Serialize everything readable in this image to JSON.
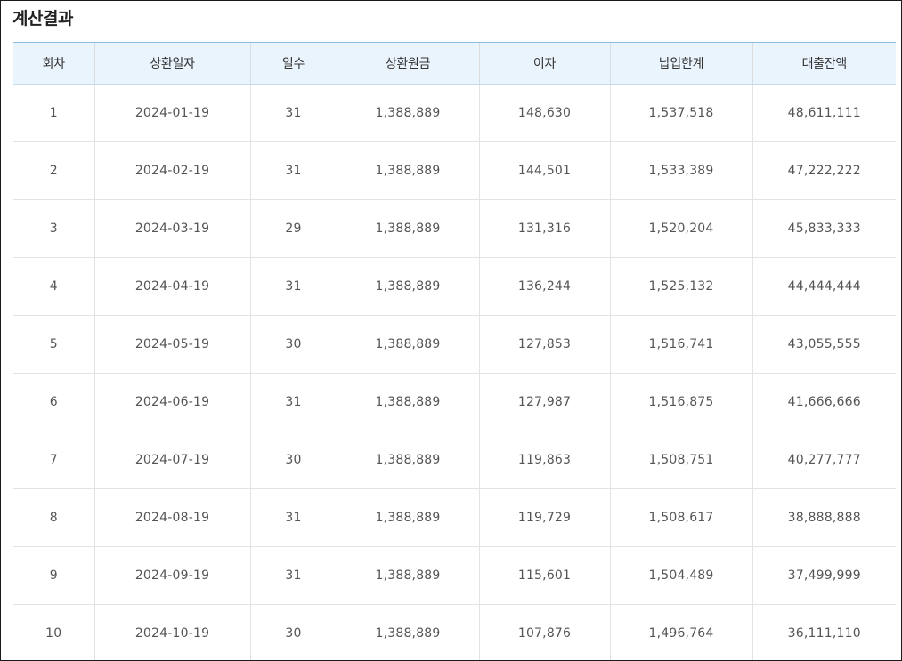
{
  "title": "계산결과",
  "table": {
    "headers": [
      "회차",
      "상환일자",
      "일수",
      "상환원금",
      "이자",
      "납입한계",
      "대출잔액"
    ],
    "rows": [
      [
        "1",
        "2024-01-19",
        "31",
        "1,388,889",
        "148,630",
        "1,537,518",
        "48,611,111"
      ],
      [
        "2",
        "2024-02-19",
        "31",
        "1,388,889",
        "144,501",
        "1,533,389",
        "47,222,222"
      ],
      [
        "3",
        "2024-03-19",
        "29",
        "1,388,889",
        "131,316",
        "1,520,204",
        "45,833,333"
      ],
      [
        "4",
        "2024-04-19",
        "31",
        "1,388,889",
        "136,244",
        "1,525,132",
        "44,444,444"
      ],
      [
        "5",
        "2024-05-19",
        "30",
        "1,388,889",
        "127,853",
        "1,516,741",
        "43,055,555"
      ],
      [
        "6",
        "2024-06-19",
        "31",
        "1,388,889",
        "127,987",
        "1,516,875",
        "41,666,666"
      ],
      [
        "7",
        "2024-07-19",
        "30",
        "1,388,889",
        "119,863",
        "1,508,751",
        "40,277,777"
      ],
      [
        "8",
        "2024-08-19",
        "31",
        "1,388,889",
        "119,729",
        "1,508,617",
        "38,888,888"
      ],
      [
        "9",
        "2024-09-19",
        "31",
        "1,388,889",
        "115,601",
        "1,504,489",
        "37,499,999"
      ],
      [
        "10",
        "2024-10-19",
        "30",
        "1,388,889",
        "107,876",
        "1,496,764",
        "36,111,110"
      ]
    ]
  },
  "colors": {
    "header_background": "#eaf4fc",
    "header_top_border": "#8fbde0",
    "title_text": "#222222",
    "cell_text": "#555555"
  }
}
